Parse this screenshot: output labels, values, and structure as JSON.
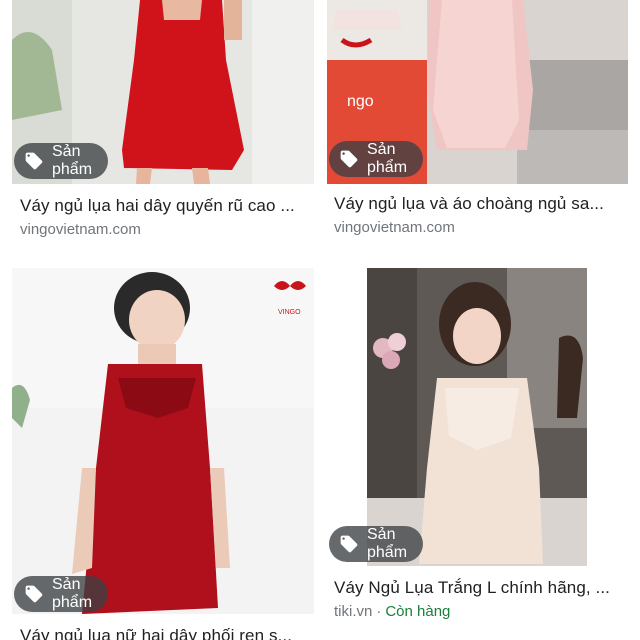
{
  "results": [
    {
      "badge": "Sản phẩm",
      "title": "Váy ngủ lụa hai dây quyến rũ cao ...",
      "source": "vingovietnam.com",
      "colors": {
        "dress": "#d0121b",
        "bg": "#e9e9e6"
      }
    },
    {
      "badge": "Sản phẩm",
      "title": "Váy ngủ lụa và áo choàng ngủ sa...",
      "source": "vingovietnam.com",
      "logo_text": "ngo",
      "colors": {
        "dress": "#f0c6c4",
        "bg": "#d9d4cf"
      }
    },
    {
      "badge": "Sản phẩm",
      "title": "Váy ngủ lụa nữ hai dây phối ren s...",
      "source": "",
      "logo_text": "VINGO",
      "colors": {
        "dress": "#b0101c",
        "bg": "#f1f1f1"
      }
    },
    {
      "badge": "Sản phẩm",
      "title": "Váy Ngủ Lụa Trắng L chính hãng, ...",
      "source": "tiki.vn",
      "stock": "Còn hàng",
      "colors": {
        "dress": "#f2e2d6",
        "bg": "#6b6460"
      }
    }
  ],
  "icons": {
    "badge": "tag-icon"
  }
}
